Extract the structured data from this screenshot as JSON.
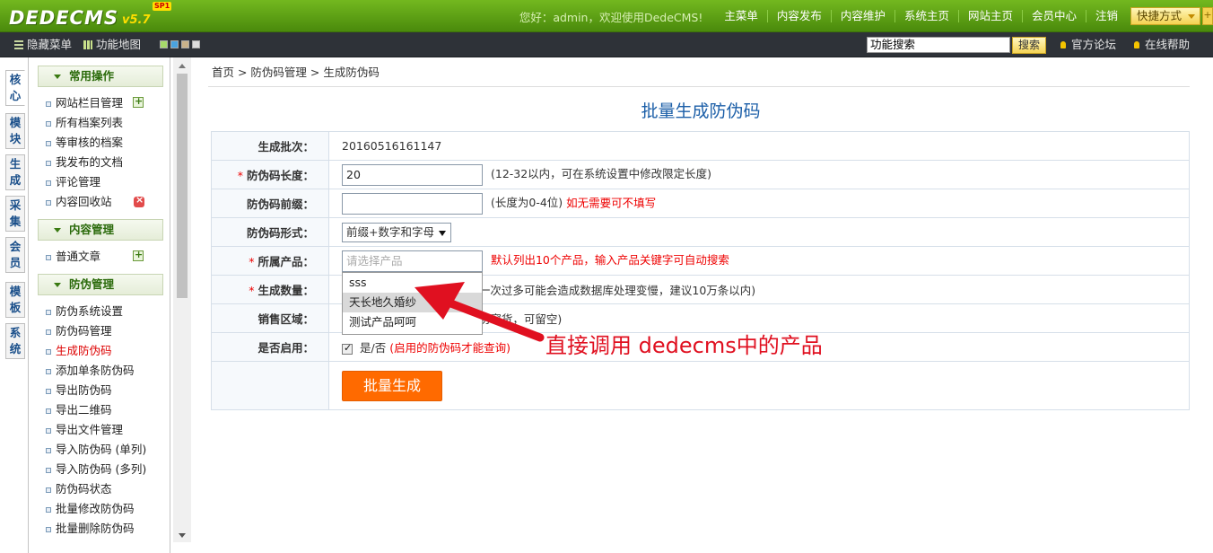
{
  "app": {
    "logo_text": "DEDECMS",
    "logo_version": "v5.7",
    "logo_badge": "SP1"
  },
  "topnav": {
    "greeting": "您好：admin，欢迎使用DedeCMS!",
    "items": [
      "主菜单",
      "内容发布",
      "内容维护",
      "系统主页",
      "网站主页",
      "会员中心",
      "注销"
    ],
    "quick_label": "快捷方式",
    "quick_more": "+"
  },
  "subbar": {
    "hide_menu": "隐藏菜单",
    "site_map": "功能地图",
    "swatch_colors": [
      "#a6d96a",
      "#4aa3df",
      "#c9b28a",
      "#dddddd"
    ],
    "search_value": "功能搜索",
    "search_button": "搜索",
    "forum_link": "官方论坛",
    "help_link": "在线帮助"
  },
  "vtabs": [
    "核心",
    "模块",
    "生成",
    "采集",
    "会员",
    "模板",
    "系统"
  ],
  "sidebar": {
    "sections": [
      {
        "title": "常用操作",
        "items": [
          "网站栏目管理",
          "所有档案列表",
          "等审核的档案",
          "我发布的文档",
          "评论管理",
          "内容回收站"
        ]
      },
      {
        "title": "内容管理",
        "items": [
          "普通文章"
        ]
      },
      {
        "title": "防伪管理",
        "items": [
          "防伪系统设置",
          "防伪码管理",
          "生成防伪码",
          "添加单条防伪码",
          "导出防伪码",
          "导出二维码",
          "导出文件管理",
          "导入防伪码 (单列)",
          "导入防伪码 (多列)",
          "防伪码状态",
          "批量修改防伪码",
          "批量删除防伪码"
        ]
      }
    ],
    "active_item": "生成防伪码"
  },
  "main": {
    "breadcrumb": "首页 > 防伪码管理 > 生成防伪码",
    "title": "批量生成防伪码",
    "form": {
      "batch": {
        "label": "生成批次：",
        "value": "20160516161147"
      },
      "length": {
        "label": "防伪码长度：",
        "value": "20",
        "hint": "(12-32以内，可在系统设置中修改限定长度)"
      },
      "prefix": {
        "label": "防伪码前缀：",
        "value": "",
        "hint": "(长度为0-4位)",
        "hint_red": "如无需要可不填写"
      },
      "format": {
        "label": "防伪码形式：",
        "value": "前缀+数字和字母"
      },
      "product": {
        "label": "所属产品：",
        "placeholder": "请选择产品",
        "hint_red": "默认列出10个产品，输入产品关键字可自动搜索"
      },
      "quantity": {
        "label": "生成数量：",
        "hint": "(一次过多可能会造成数据库处理变慢，建议10万条以内)"
      },
      "region": {
        "label": "销售区域：",
        "hint": "(防窜货，可留空)"
      },
      "enabled": {
        "label": "是否启用：",
        "text": "是/否",
        "hint": "(启用的防伪码才能查询)"
      },
      "required_mark": "*",
      "submit": "批量生成"
    },
    "suggestions": [
      "sss",
      "天长地久婚纱",
      "测试产品呵呵"
    ],
    "annotation": "直接调用 dedecms中的产品"
  }
}
